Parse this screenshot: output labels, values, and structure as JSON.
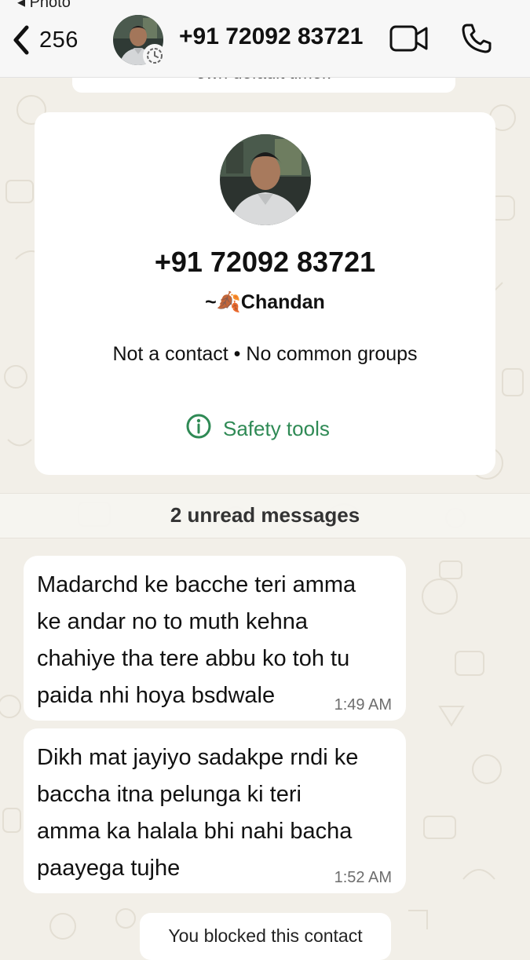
{
  "header": {
    "status_cut_text": "◂ Photo",
    "back_count": "256",
    "contact_title": "+91 72092 83721",
    "back_icon": "chevron-left",
    "video_icon": "video-camera",
    "call_icon": "phone",
    "timer_icon": "disappearing-timer"
  },
  "system_note_top": {
    "text": "own default timer."
  },
  "profile_card": {
    "phone": "+91 72092 83721",
    "name": "~🍂Chandan",
    "meta": "Not a contact • No common groups",
    "safety_tools_label": "Safety tools",
    "safety_icon": "info-circle"
  },
  "unread_banner": {
    "text": "2 unread messages"
  },
  "messages": [
    {
      "text": "Madarchd ke bacche teri amma\nke andar no to muth kehna\nchahiye tha tere abbu ko toh tu\npaida nhi hoya bsdwale",
      "time": "1:49 AM"
    },
    {
      "text": "Dikh mat jayiyo sadakpe rndi ke\nbaccha itna pelunga ki teri\namma ka halala bhi nahi bacha\npaayega tujhe",
      "time": "1:52 AM"
    }
  ],
  "blocked_note": {
    "text": "You blocked this contact"
  },
  "colors": {
    "accent_green": "#2f8a55",
    "bubble_bg": "#ffffff",
    "wallpaper": "#f2efe8"
  }
}
